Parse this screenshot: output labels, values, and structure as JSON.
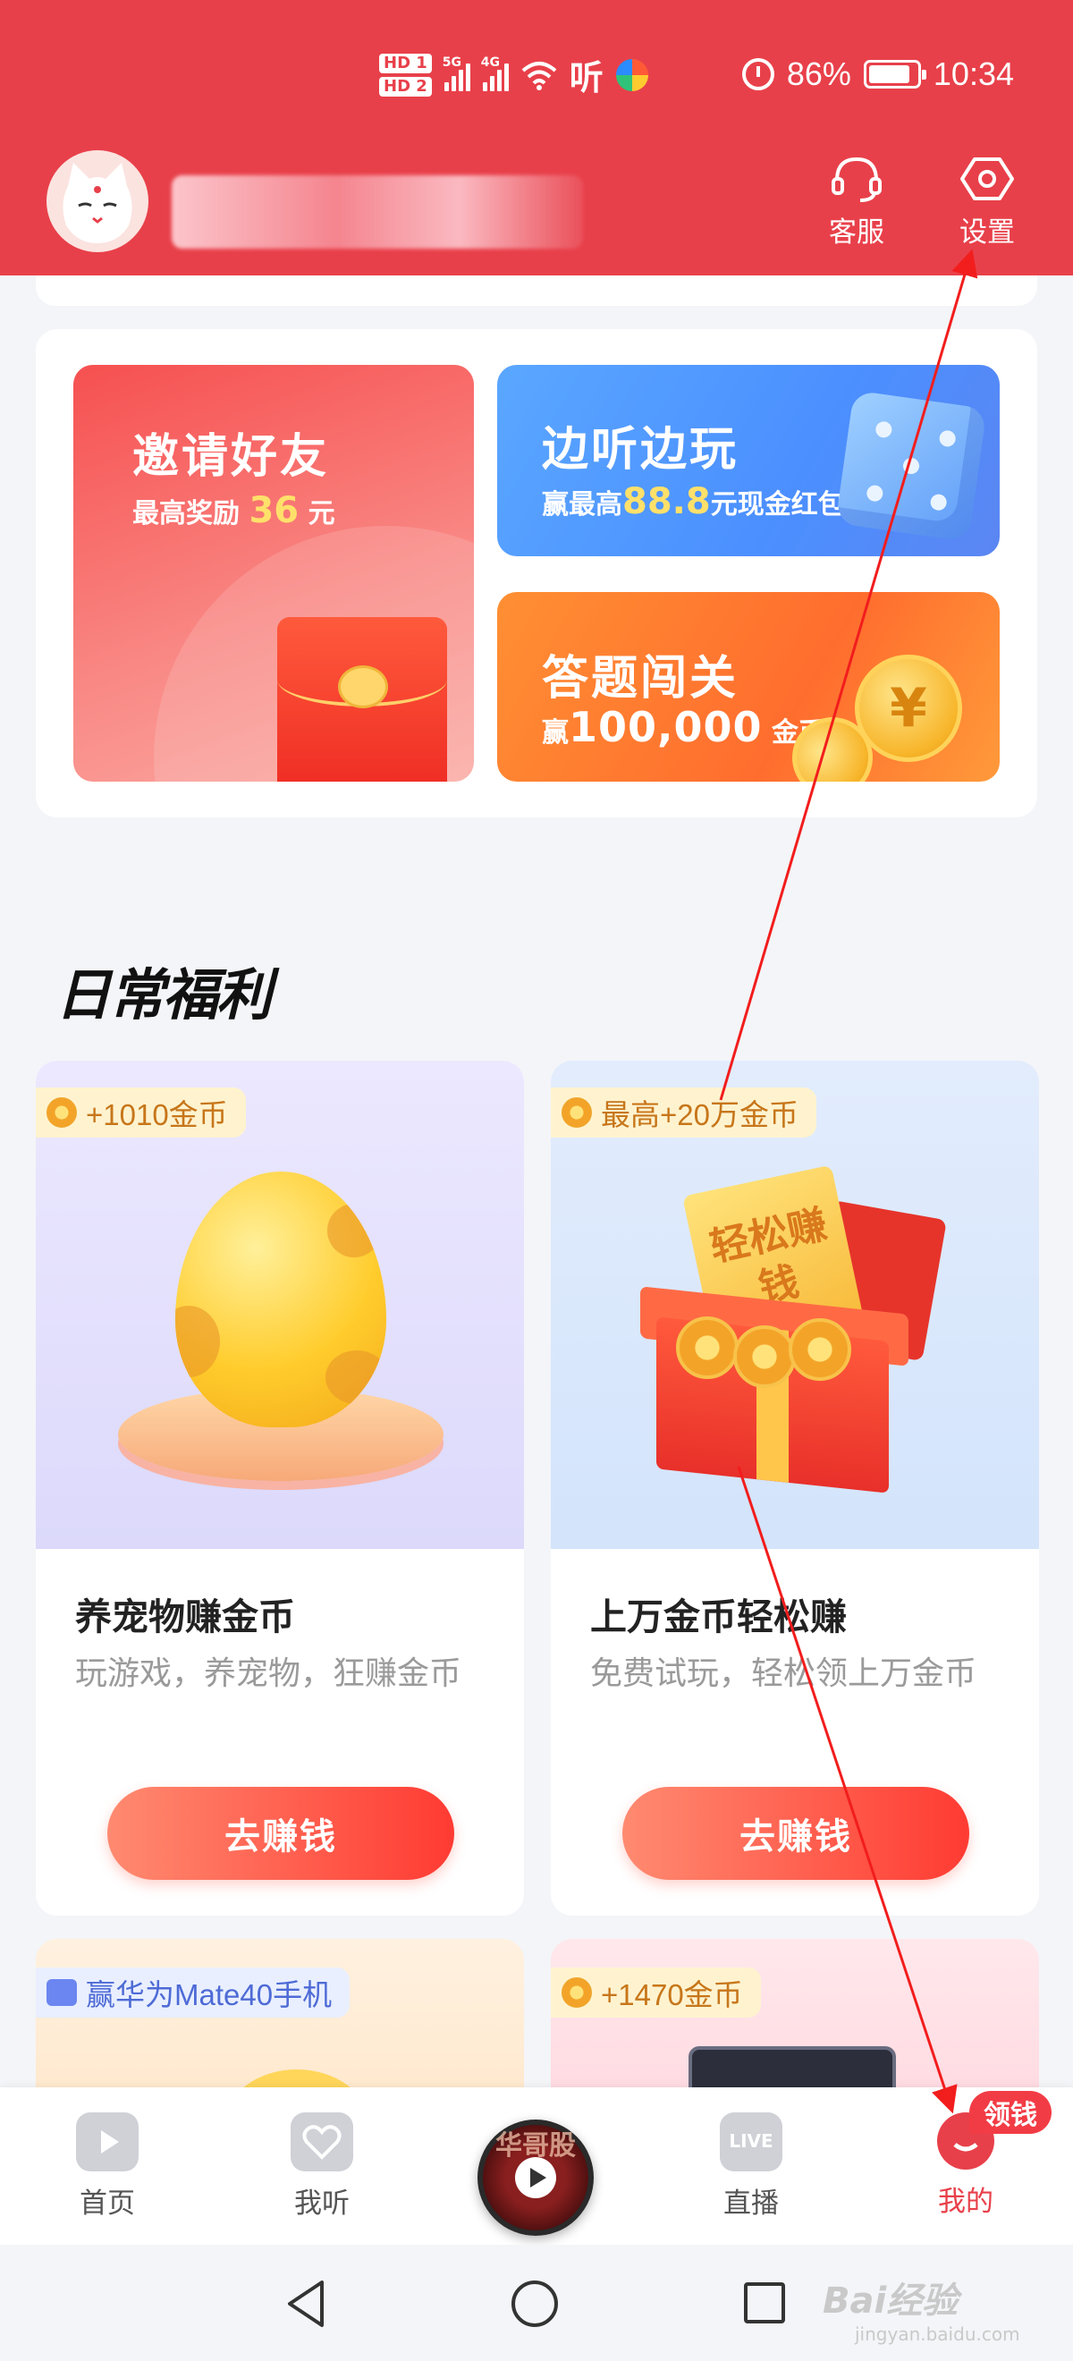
{
  "status_bar": {
    "hd1": "HD 1",
    "hd2": "HD 2",
    "sig1_label": "5G",
    "sig2_label": "4G",
    "app_label": "听",
    "battery": "86%",
    "time": "10:34"
  },
  "header": {
    "service_label": "客服",
    "settings_label": "设置"
  },
  "promo": {
    "invite": {
      "title": "邀请好友",
      "sub_prefix": "最高奖励 ",
      "sub_value": "36",
      "sub_suffix": " 元"
    },
    "play": {
      "title": "边听边玩",
      "sub_prefix": "赢最高",
      "sub_value": "88.8",
      "sub_suffix": "元现金红包"
    },
    "quiz": {
      "title": "答题闯关",
      "sub_prefix": "赢",
      "sub_value": "100,000",
      "sub_suffix": " 金币"
    }
  },
  "daily": {
    "title": "日常福利",
    "cards": [
      {
        "badge": "+1010金币",
        "title": "养宠物赚金币",
        "desc": "玩游戏，养宠物，狂赚金币",
        "button": "去赚钱"
      },
      {
        "badge": "最高+20万金币",
        "title": "上万金币轻松赚",
        "desc": "免费试玩，轻松领上万金币",
        "button": "去赚钱",
        "art_text": "轻松赚钱"
      }
    ],
    "peek_cards": [
      {
        "badge": "赢华为Mate40手机"
      },
      {
        "badge": "+1470金币"
      }
    ]
  },
  "bottom_nav": {
    "items": [
      {
        "label": "首页"
      },
      {
        "label": "我听"
      },
      {
        "label": "直播",
        "icon_text": "LIVE"
      },
      {
        "label": "我的"
      }
    ],
    "disc_text": "华哥股",
    "claim_badge": "领钱"
  },
  "watermark": {
    "brand": "Bai经验",
    "url": "jingyan.baidu.com"
  },
  "colors": {
    "brand_red": "#e8404a",
    "button_gradient_end": "#ff3b33",
    "coin_gold": "#f3a428"
  }
}
